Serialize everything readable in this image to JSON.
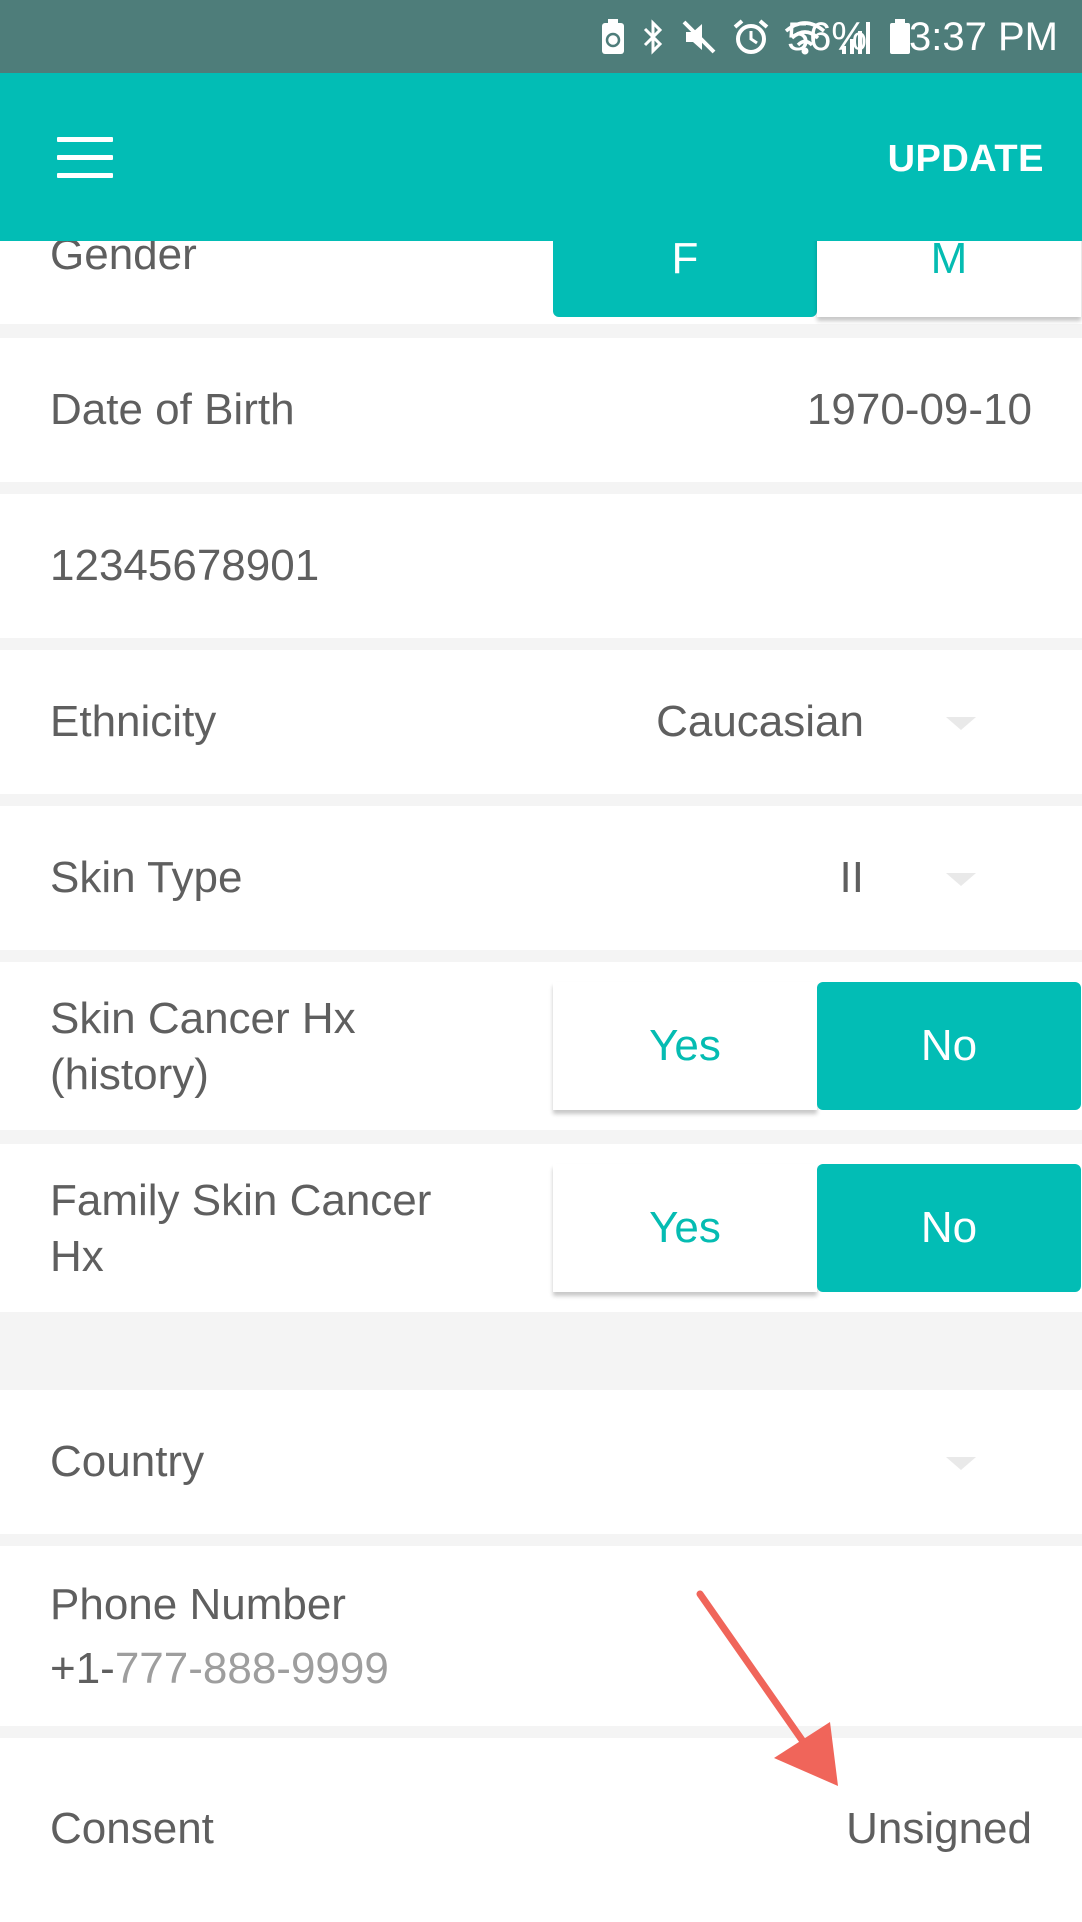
{
  "status_bar": {
    "battery_percent": "56%",
    "time": "3:37 PM",
    "icons": [
      "battery-saver-icon",
      "bluetooth-icon",
      "mute-icon",
      "alarm-icon",
      "wifi-icon",
      "signal-icon",
      "battery-icon"
    ]
  },
  "app_bar": {
    "update_label": "UPDATE",
    "menu_icon": "hamburger-menu-icon"
  },
  "form": {
    "gender": {
      "label": "Gender",
      "options": [
        "F",
        "M"
      ],
      "selected": "F"
    },
    "dob": {
      "label": "Date of Birth",
      "value": "1970-09-10"
    },
    "id_number": {
      "value": "12345678901"
    },
    "ethnicity": {
      "label": "Ethnicity",
      "value": "Caucasian"
    },
    "skin_type": {
      "label": "Skin Type",
      "value": "II"
    },
    "skin_cancer_hx": {
      "label_line1": "Skin Cancer Hx",
      "label_line2": "(history)",
      "yes": "Yes",
      "no": "No",
      "selected": "No"
    },
    "family_hx": {
      "label_line1": "Family Skin Cancer",
      "label_line2": "Hx",
      "yes": "Yes",
      "no": "No",
      "selected": "No"
    },
    "country": {
      "label": "Country",
      "value": ""
    },
    "phone": {
      "label": "Phone Number",
      "prefix": "+1-",
      "placeholder": "777-888-9999"
    },
    "consent": {
      "label": "Consent",
      "value": "Unsigned"
    }
  },
  "colors": {
    "accent": "#02bdb5",
    "status_bar": "#4e7d7a",
    "annotation_arrow": "#f0655a"
  }
}
